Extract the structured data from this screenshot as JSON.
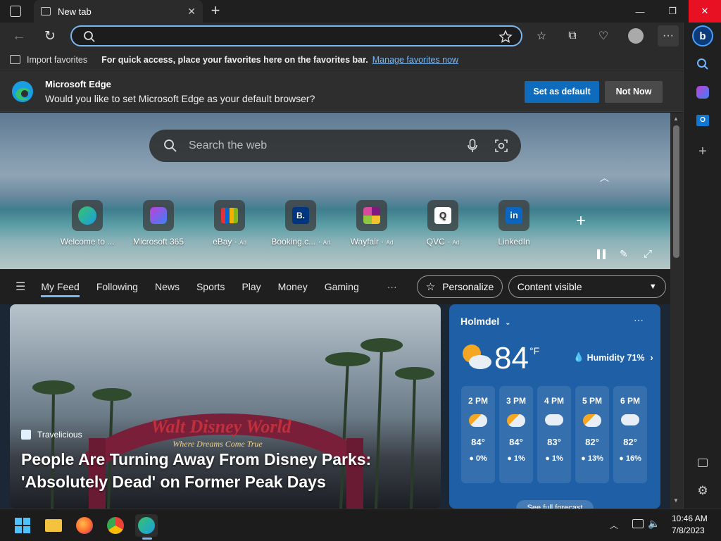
{
  "browser": {
    "tab_title": "New tab",
    "address_value": "",
    "favorites_bar": {
      "import_label": "Import favorites",
      "message": "For quick access, place your favorites here on the favorites bar.",
      "manage_link": "Manage favorites now"
    },
    "infobar": {
      "app_name": "Microsoft Edge",
      "question": "Would you like to set Microsoft Edge as your default browser?",
      "primary_button": "Set as default",
      "secondary_button": "Not Now"
    }
  },
  "newtab": {
    "search_placeholder": "Search the web",
    "quick_links": [
      {
        "label": "Welcome to ...",
        "ad": ""
      },
      {
        "label": "Microsoft 365",
        "ad": ""
      },
      {
        "label": "eBay",
        "ad": "Ad"
      },
      {
        "label": "Booking.c...",
        "ad": "Ad"
      },
      {
        "label": "Wayfair",
        "ad": "Ad"
      },
      {
        "label": "QVC",
        "ad": "Ad"
      },
      {
        "label": "LinkedIn",
        "ad": ""
      }
    ],
    "feed_tabs": [
      "My Feed",
      "Following",
      "News",
      "Sports",
      "Play",
      "Money",
      "Gaming"
    ],
    "more_tabs": "···",
    "personalize_label": "Personalize",
    "content_visible_label": "Content visible",
    "article": {
      "source": "Travelicious",
      "headline_line1": "People Are Turning Away From Disney Parks:",
      "headline_line2": "'Absolutely Dead' on Former Peak Days",
      "sign_line1": "Walt Disney World",
      "sign_line2": "Where Dreams Come True"
    },
    "weather": {
      "location": "Holmdel",
      "temperature": "84",
      "unit": "°F",
      "humidity": "Humidity 71%",
      "forecast_button": "See full forecast",
      "hourly": [
        {
          "time": "2 PM",
          "temp": "84°",
          "precip": "0%"
        },
        {
          "time": "3 PM",
          "temp": "84°",
          "precip": "1%"
        },
        {
          "time": "4 PM",
          "temp": "83°",
          "precip": "1%"
        },
        {
          "time": "5 PM",
          "temp": "82°",
          "precip": "13%"
        },
        {
          "time": "6 PM",
          "temp": "82°",
          "precip": "16%"
        }
      ]
    }
  },
  "taskbar": {
    "time": "10:46 AM",
    "date": "7/8/2023"
  },
  "colors": {
    "accent": "#0f6cbd",
    "link": "#7ab6f0",
    "close_red": "#e81123",
    "weather_bg": "#1f5fa5"
  }
}
